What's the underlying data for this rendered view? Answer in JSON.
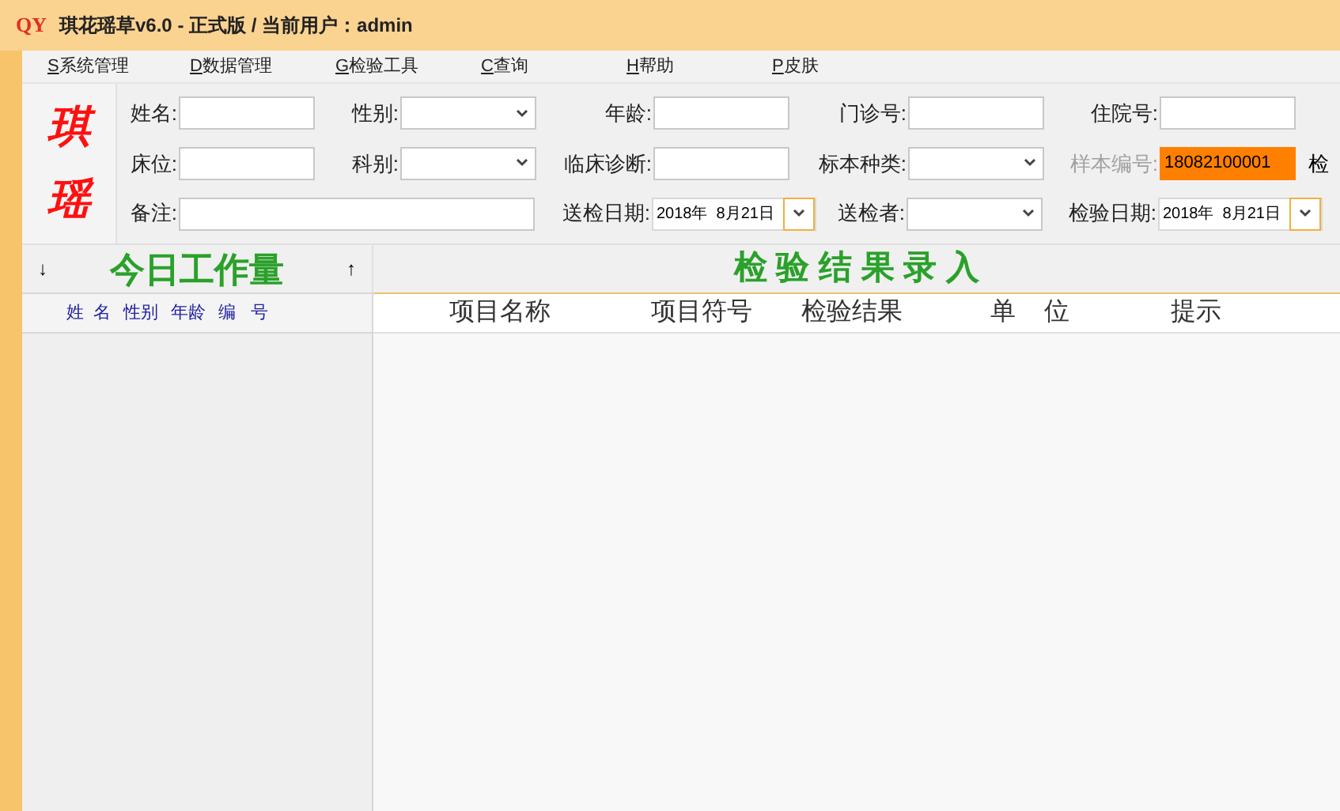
{
  "window": {
    "title": "琪花瑶草v6.0 - 正式版 / 当前用户：admin",
    "logo": "QY"
  },
  "menu": [
    {
      "key": "S",
      "label": "系统管理"
    },
    {
      "key": "D",
      "label": "数据管理"
    },
    {
      "key": "G",
      "label": "检验工具"
    },
    {
      "key": "C",
      "label": "查询"
    },
    {
      "key": "H",
      "label": "帮助"
    },
    {
      "key": "P",
      "label": "皮肤"
    }
  ],
  "brand": [
    "琪",
    "瑶"
  ],
  "form_rows": [
    [
      {
        "label": "姓名:",
        "kind": "text"
      },
      {
        "label": "性别:",
        "kind": "select"
      },
      {
        "label": "年龄:",
        "kind": "text"
      },
      {
        "label": "门诊号:",
        "kind": "text"
      },
      {
        "label": "住院号:",
        "kind": "text"
      }
    ],
    [
      {
        "label": "床位:",
        "kind": "text"
      },
      {
        "label": "科别:",
        "kind": "select"
      },
      {
        "label": "临床诊断:",
        "kind": "text"
      },
      {
        "label": "标本种类:",
        "kind": "select"
      },
      {
        "label": "样本编号:",
        "kind": "highlight",
        "disabled": true,
        "value": "18082100001"
      },
      {
        "label": "检",
        "kind": "label_only"
      }
    ],
    [
      {
        "label": "备注:",
        "kind": "wide"
      },
      {
        "label": "送检日期:",
        "kind": "date",
        "value": "2018年  8月21日"
      },
      {
        "label": "送检者:",
        "kind": "select"
      },
      {
        "label": "检验日期:",
        "kind": "date",
        "value": "2018年  8月21日"
      }
    ]
  ],
  "workload": {
    "down": "↓",
    "title": "今日工作量",
    "up": "↑",
    "columns": [
      "姓  名",
      "性别",
      "年龄",
      "编   号"
    ]
  },
  "results": {
    "title": "检 验 结 果 录 入",
    "columns": [
      "项目名称",
      "项目符号",
      "检验结果",
      "单    位",
      "提示"
    ]
  }
}
